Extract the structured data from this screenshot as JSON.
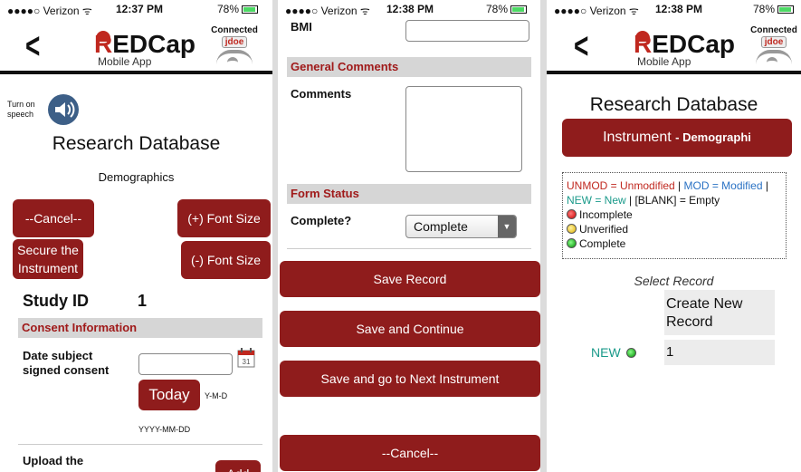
{
  "status": {
    "carrier": "●●●●○ Verizon ᯤ",
    "battery": "78%",
    "p1_time": "12:37 PM",
    "p2_time": "12:38 PM",
    "p3_time": "12:38 PM"
  },
  "header": {
    "back_glyph": "<",
    "logo_word_r": "R",
    "logo_word_rest": "EDCap",
    "logo_sub": "Mobile App",
    "connected_label": "Connected",
    "user": "jdoe"
  },
  "colors": {
    "accent": "#8f1c1c",
    "section_text": "#a01a1a",
    "section_bg": "#d6d6d6",
    "unmod": "#c0281f",
    "mod": "#2a72c4",
    "new": "#1a9a8a"
  },
  "screen1": {
    "speech_label_1": "Turn on",
    "speech_label_2": "speech",
    "db_title": "Research Database",
    "instrument": "Demographics",
    "cancel_btn": "--Cancel--",
    "font_up_btn": "(+) Font Size",
    "secure_btn_1": "Secure the",
    "secure_btn_2": "Instrument",
    "font_down_btn": "(-) Font Size",
    "study_id_label": "Study ID",
    "study_id_value": "1",
    "consent_section": "Consent Information",
    "date_label_1": "Date subject",
    "date_label_2": "signed consent",
    "today_btn": "Today",
    "date_format_short": "Y-M-D",
    "date_format_hint": "YYYY-MM-DD",
    "upload_label": "Upload the",
    "upload_btn": "Add"
  },
  "screen2": {
    "bmi_label": "BMI",
    "comments_section": "General Comments",
    "comments_label": "Comments",
    "form_status_section": "Form Status",
    "complete_label": "Complete?",
    "complete_value": "Complete",
    "save_record_btn": "Save Record",
    "save_continue_btn": "Save and Continue",
    "save_next_btn": "Save and go to Next Instrument",
    "cancel_btn": "--Cancel--"
  },
  "screen3": {
    "db_title": "Research Database",
    "instrument_prefix": "Instrument",
    "instrument_name": "- Demographi",
    "legend": {
      "unmod": "UNMOD = Unmodified",
      "sep1": " | ",
      "mod": "MOD = Modified",
      "sep2": " |",
      "new": "NEW = New",
      "blank": " | [BLANK] = Empty",
      "incomplete": "Incomplete",
      "unverified": "Unverified",
      "complete": "Complete"
    },
    "select_record": "Select Record",
    "create_new_1": "Create New",
    "create_new_2": "Record",
    "new_tag": "NEW",
    "record_id": "1"
  }
}
